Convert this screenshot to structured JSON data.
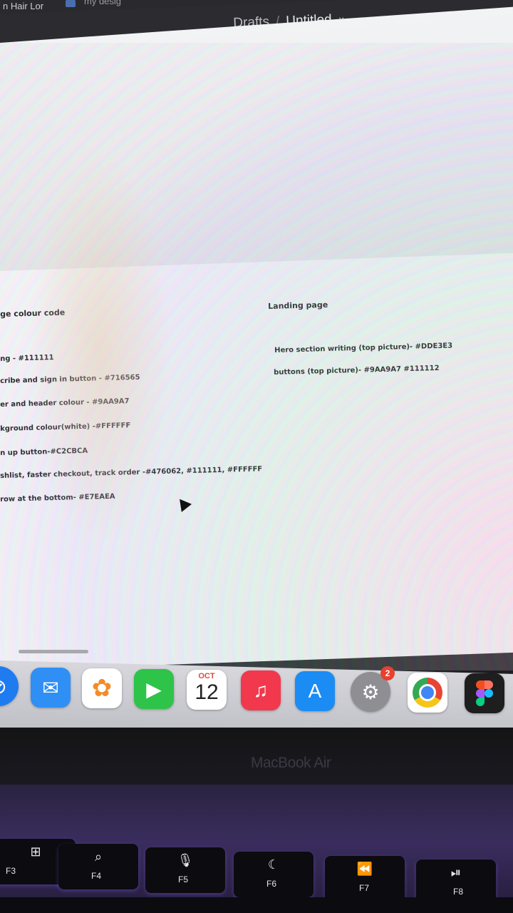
{
  "browser": {
    "tab_1": "n Hair Lor",
    "tab_2": "my desig"
  },
  "figma": {
    "breadcrumb_project": "Drafts",
    "breadcrumb_separator": "/",
    "breadcrumb_file": "Untitled",
    "chevron": "˅"
  },
  "notes_left": [
    "ge colour code",
    "ng - #111111",
    "cribe and sign in button - #716565",
    "er and header colour - #9AA9A7",
    "kground colour(white) -#FFFFFF",
    "n up  button-#C2CBCA",
    "shlist, faster checkout, track order -#476062, #111111, #FFFFFF",
    "row at the bottom- #E7EAEA"
  ],
  "notes_right": [
    "Landing page",
    "Hero section writing (top picture)- #DDE3E3",
    "buttons (top picture)- #9AA9A7 #111112"
  ],
  "dock": {
    "items": [
      {
        "name": "safari-icon",
        "color": "#1e7cf0"
      },
      {
        "name": "mail-icon",
        "color": "#2f8ff5"
      },
      {
        "name": "photos-icon",
        "color": "#ffffff"
      },
      {
        "name": "facetime-icon",
        "color": "#2ec44a"
      },
      {
        "name": "calendar-icon",
        "color": "#ffffff"
      },
      {
        "name": "music-icon",
        "color": "#f2384c"
      },
      {
        "name": "app-store-icon",
        "color": "#1b8cf3"
      },
      {
        "name": "system-settings-icon",
        "color": "#8e8e93"
      },
      {
        "name": "chrome-icon",
        "color": "#ffffff"
      },
      {
        "name": "figma-icon",
        "color": "#1e1e1e"
      }
    ],
    "calendar_month": "OCT",
    "calendar_day": "12",
    "settings_badge": "2"
  },
  "device": {
    "label": "MacBook Air"
  },
  "keyboard": {
    "keys": [
      {
        "label": "F3",
        "icon": "mission-control-icon",
        "glyph": "⊞"
      },
      {
        "label": "F4",
        "icon": "spotlight-icon",
        "glyph": "⌕"
      },
      {
        "label": "F5",
        "icon": "dictation-icon",
        "glyph": "🎙"
      },
      {
        "label": "F6",
        "icon": "do-not-disturb-icon",
        "glyph": "☾"
      },
      {
        "label": "F7",
        "icon": "rewind-icon",
        "glyph": "⏪"
      },
      {
        "label": "F8",
        "icon": "play-pause-icon",
        "glyph": "⏯"
      }
    ]
  }
}
